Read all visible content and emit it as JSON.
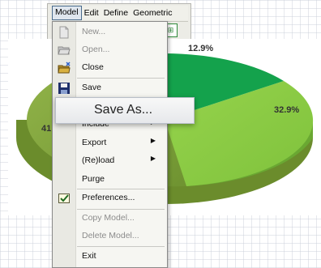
{
  "menubar": {
    "items": [
      "Model",
      "Edit",
      "Define",
      "Geometric"
    ]
  },
  "chart": {
    "labels": [
      "12.9%",
      "32.9%",
      "41"
    ],
    "colors": {
      "dark_green": "#15a04b",
      "light_green": "#8ccc44",
      "olive": "#7ea23c"
    }
  },
  "menu": {
    "items": [
      {
        "label": "New...",
        "icon": "new-file-icon",
        "enabled": false
      },
      {
        "label": "Open...",
        "icon": "open-folder-icon",
        "enabled": false
      },
      {
        "label": "Close",
        "icon": "close-folder-icon",
        "enabled": true
      },
      {
        "label": "Save",
        "icon": "floppy-disk-icon",
        "enabled": true
      },
      {
        "label": "Save As...",
        "enabled": true,
        "highlighted": true
      },
      {
        "label": "Include",
        "enabled": true,
        "submenu": true
      },
      {
        "label": "Export",
        "enabled": true,
        "submenu": true
      },
      {
        "label": "(Re)load",
        "enabled": true,
        "submenu": true
      },
      {
        "label": "Purge",
        "enabled": true
      },
      {
        "label": "Preferences...",
        "icon": "checkbox-icon",
        "enabled": true
      },
      {
        "label": "Copy Model...",
        "enabled": false
      },
      {
        "label": "Delete Model...",
        "enabled": false
      },
      {
        "label": "Exit",
        "enabled": true
      }
    ]
  }
}
